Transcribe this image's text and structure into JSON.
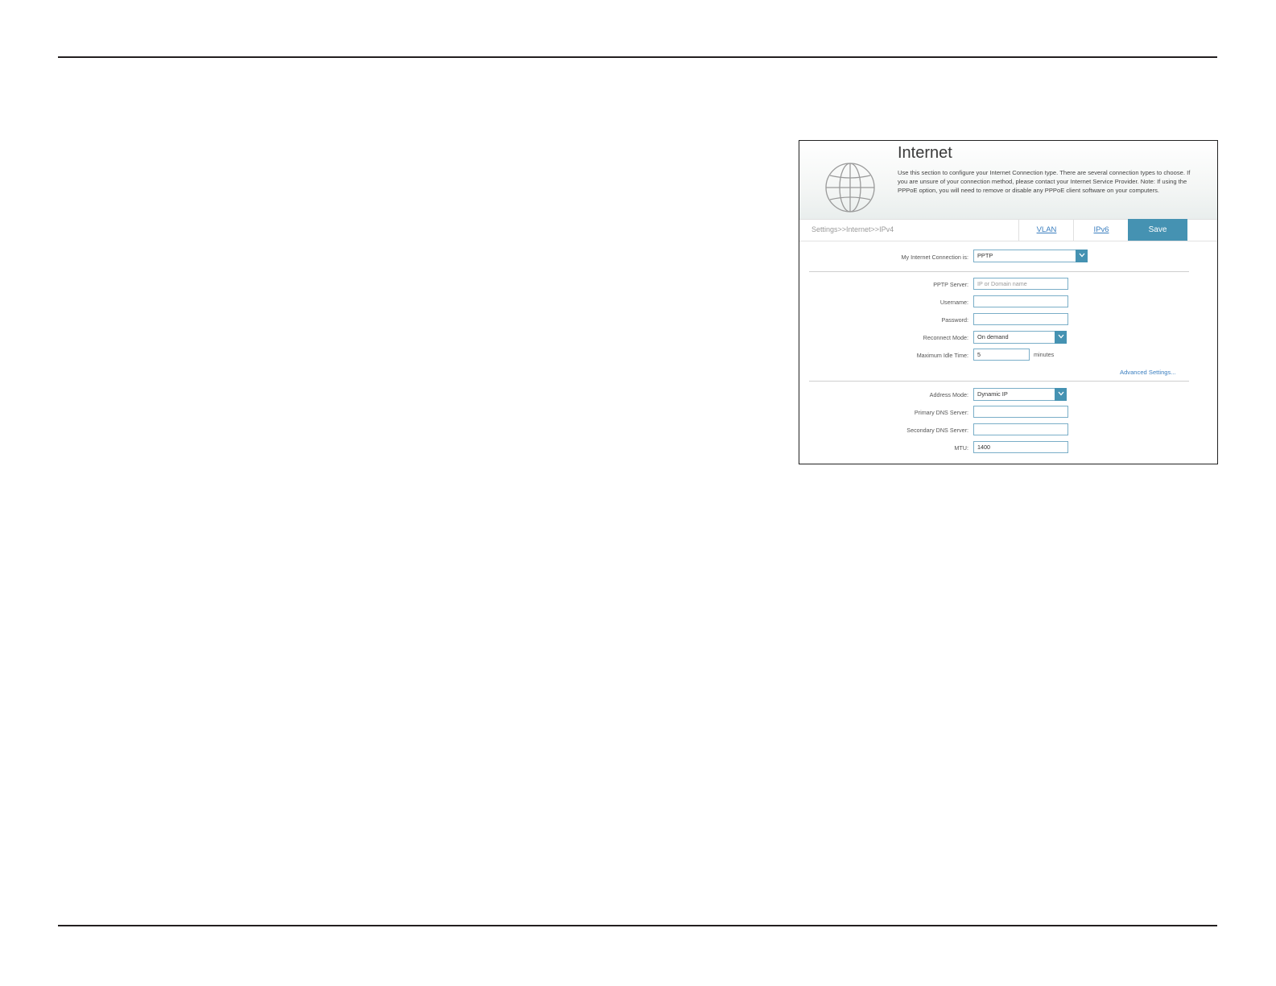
{
  "page": {
    "title": "Internet",
    "description": "Use this section to configure your Internet Connection type. There are several connection types to choose. If you are unsure of your connection method, please contact your Internet Service Provider. Note: If using the PPPoE option, you will need to remove or disable any PPPoE client software on your computers.",
    "breadcrumb": "Settings>>Internet>>IPv4"
  },
  "nav": {
    "vlan_label": "VLAN",
    "ipv6_label": "IPv6",
    "save_label": "Save"
  },
  "form": {
    "connection_label": "My Internet Connection is:",
    "connection_value": "PPTP",
    "pptp_server_label": "PPTP Server:",
    "pptp_server_placeholder": "IP or Domain name",
    "username_label": "Username:",
    "username_value": "",
    "password_label": "Password:",
    "password_value": "",
    "reconnect_label": "Reconnect Mode:",
    "reconnect_value": "On demand",
    "idle_label": "Maximum Idle Time:",
    "idle_value": "5",
    "idle_unit": "minutes",
    "advanced_link": "Advanced Settings...",
    "address_mode_label": "Address Mode:",
    "address_mode_value": "Dynamic IP",
    "primary_dns_label": "Primary DNS Server:",
    "primary_dns_value": "",
    "secondary_dns_label": "Secondary DNS Server:",
    "secondary_dns_value": "",
    "mtu_label": "MTU:",
    "mtu_value": "1400"
  },
  "colors": {
    "accent": "#4592b2",
    "link": "#3b7fc0",
    "field_border": "#7aaec8"
  }
}
